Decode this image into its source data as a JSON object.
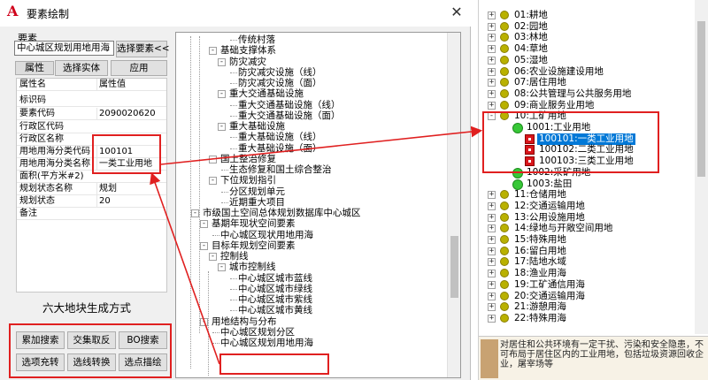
{
  "dialog": {
    "title": "要素绘制",
    "app_icon": "autocad-logo-icon",
    "close_icon": "close-icon",
    "element_label": "要素",
    "element_value": "中心城区规划用地用海",
    "select_element_label": "选择要素<<",
    "attr_tab_label": "属性",
    "select_entity_label": "选择实体",
    "apply_label": "应用"
  },
  "properties": {
    "header": {
      "key": "属性名",
      "value": "属性值"
    },
    "rows": [
      {
        "key": "标识码",
        "value": ""
      },
      {
        "key": "要素代码",
        "value": "2090020620"
      },
      {
        "key": "行政区代码",
        "value": ""
      },
      {
        "key": "行政区名称",
        "value": ""
      },
      {
        "key": "用地用海分类代码",
        "value": "100101"
      },
      {
        "key": "用地用海分类名称",
        "value": "一类工业用地"
      },
      {
        "key": "面积(平方米#2)",
        "value": ""
      },
      {
        "key": "规划状态名称",
        "value": "规划"
      },
      {
        "key": "规划状态",
        "value": "20"
      },
      {
        "key": "备注",
        "value": ""
      }
    ]
  },
  "generation": {
    "title": "六大地块生成方式",
    "buttons": [
      "累加搜索",
      "交集取反",
      "BO搜索",
      "选项充转",
      "选线转换",
      "选点描绘"
    ]
  },
  "tree": {
    "nodes": [
      {
        "label": "传统村落",
        "level": 4
      },
      {
        "label": "基础支撑体系",
        "level": 2
      },
      {
        "label": "防灾减灾",
        "level": 3
      },
      {
        "label": "防灾减灾设施（线）",
        "level": 4
      },
      {
        "label": "防灾减灾设施（面）",
        "level": 4
      },
      {
        "label": "重大交通基础设施",
        "level": 3
      },
      {
        "label": "重大交通基础设施（线）",
        "level": 4
      },
      {
        "label": "重大交通基础设施（面）",
        "level": 4
      },
      {
        "label": "重大基础设施",
        "level": 3
      },
      {
        "label": "重大基础设施（线）",
        "level": 4
      },
      {
        "label": "重大基础设施（面）",
        "level": 4
      },
      {
        "label": "国土整治修复",
        "level": 2
      },
      {
        "label": "生态修复和国土综合整治",
        "level": 3
      },
      {
        "label": "下位规划指引",
        "level": 2
      },
      {
        "label": "分区规划单元",
        "level": 3
      },
      {
        "label": "近期重大项目",
        "level": 3
      },
      {
        "label": "市级国土空间总体规划数据库中心城区",
        "level": 0
      },
      {
        "label": "基期年现状空间要素",
        "level": 1
      },
      {
        "label": "中心城区现状用地用海",
        "level": 2
      },
      {
        "label": "目标年规划空间要素",
        "level": 1
      },
      {
        "label": "控制线",
        "level": 2
      },
      {
        "label": "城市控制线",
        "level": 3
      },
      {
        "label": "中心城区城市蓝线",
        "level": 4
      },
      {
        "label": "中心城区城市绿线",
        "level": 4
      },
      {
        "label": "中心城区城市紫线",
        "level": 4
      },
      {
        "label": "中心城区城市黄线",
        "level": 4
      },
      {
        "label": "用地结构与分布",
        "level": 1
      },
      {
        "label": "中心城区规划分区",
        "level": 2
      },
      {
        "label": "中心城区规划用地用海",
        "level": 2
      }
    ]
  },
  "category_tree": {
    "nodes": [
      {
        "label": "01:耕地",
        "kind": "dot",
        "level": 0
      },
      {
        "label": "02:园地",
        "kind": "dot",
        "level": 0
      },
      {
        "label": "03:林地",
        "kind": "dot",
        "level": 0
      },
      {
        "label": "04:草地",
        "kind": "dot",
        "level": 0
      },
      {
        "label": "05:湿地",
        "kind": "dot",
        "level": 0
      },
      {
        "label": "06:农业设施建设用地",
        "kind": "dot",
        "level": 0
      },
      {
        "label": "07:居住用地",
        "kind": "dot",
        "level": 0
      },
      {
        "label": "08:公共管理与公共服务用地",
        "kind": "dot",
        "level": 0
      },
      {
        "label": "09:商业服务业用地",
        "kind": "dot",
        "level": 0
      },
      {
        "label": "10:工矿用地",
        "kind": "dot",
        "level": 0
      },
      {
        "label": "1001:工业用地",
        "kind": "green",
        "level": 1
      },
      {
        "label": "100101:一类工业用地",
        "kind": "red",
        "level": 2,
        "selected": true
      },
      {
        "label": "100102:二类工业用地",
        "kind": "red",
        "level": 2
      },
      {
        "label": "100103:三类工业用地",
        "kind": "red",
        "level": 2
      },
      {
        "label": "1002:采矿用地",
        "kind": "green",
        "level": 1
      },
      {
        "label": "1003:盐田",
        "kind": "green",
        "level": 1
      },
      {
        "label": "11:仓储用地",
        "kind": "dot",
        "level": 0
      },
      {
        "label": "12:交通运输用地",
        "kind": "dot",
        "level": 0
      },
      {
        "label": "13:公用设施用地",
        "kind": "dot",
        "level": 0
      },
      {
        "label": "14:绿地与开敞空间用地",
        "kind": "dot",
        "level": 0
      },
      {
        "label": "15:特殊用地",
        "kind": "dot",
        "level": 0
      },
      {
        "label": "16:留白用地",
        "kind": "dot",
        "level": 0
      },
      {
        "label": "17:陆地水域",
        "kind": "dot",
        "level": 0
      },
      {
        "label": "18:渔业用海",
        "kind": "dot",
        "level": 0
      },
      {
        "label": "19:工矿通信用海",
        "kind": "dot",
        "level": 0
      },
      {
        "label": "20:交通运输用海",
        "kind": "dot",
        "level": 0
      },
      {
        "label": "21:游憩用海",
        "kind": "dot",
        "level": 0
      },
      {
        "label": "22:特殊用海",
        "kind": "dot",
        "level": 0
      }
    ],
    "description": "对居住和公共环境有一定干扰、污染和安全隐患，不可布局于居住区内的工业用地，包括垃圾资源回收企业，屠宰场等"
  },
  "colors": {
    "highlight": "#e02020",
    "selection": "#0078d7"
  }
}
